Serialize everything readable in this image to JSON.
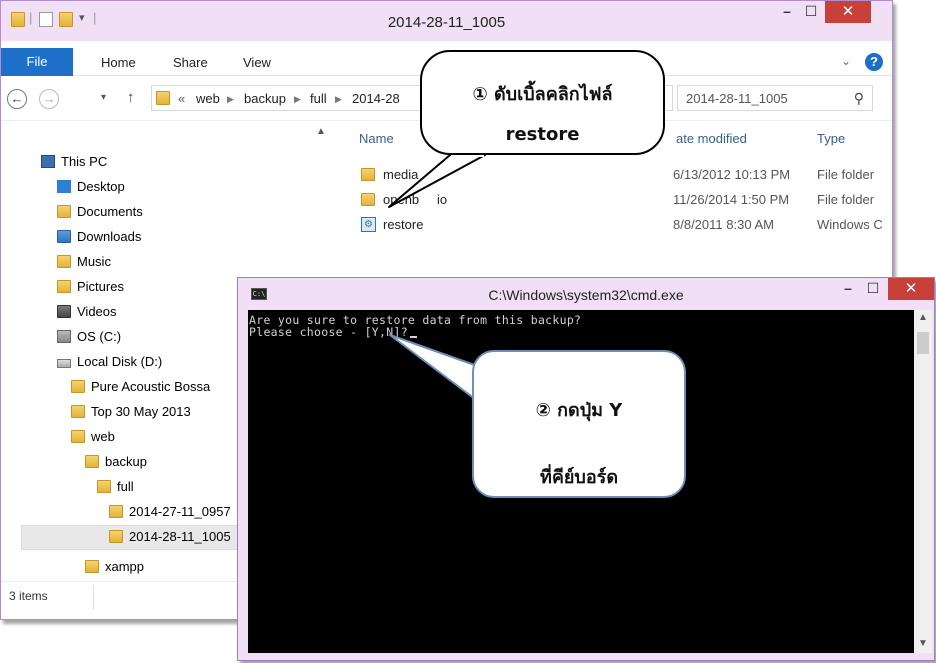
{
  "explorer": {
    "title": "2014-28-11_1005",
    "ribbon": {
      "file": "File",
      "home": "Home",
      "share": "Share",
      "view": "View",
      "help": "?"
    },
    "address": {
      "overflow": "«",
      "crumbs": [
        "web",
        "backup",
        "full",
        "2014-28"
      ]
    },
    "search_text": "2014-28-11_1005",
    "nav": {
      "this_pc": "This PC",
      "desktop": "Desktop",
      "documents": "Documents",
      "downloads": "Downloads",
      "music": "Music",
      "pictures": "Pictures",
      "videos": "Videos",
      "os": "OS (C:)",
      "local_disk": "Local Disk (D:)",
      "pure": "Pure Acoustic Bossa",
      "top30": "Top 30 May 2013",
      "web": "web",
      "backup": "backup",
      "full": "full",
      "d0957": "2014-27-11_0957",
      "d1005": "2014-28-11_1005",
      "xampp": "xampp"
    },
    "columns": {
      "name": "Name",
      "date": "ate modified",
      "type": "Type"
    },
    "files": [
      {
        "name": "media",
        "date": "6/13/2012 10:13 PM",
        "type": "File folder",
        "icon": "folder-icon"
      },
      {
        "name": "openbiblio",
        "visible_name": "openb",
        "visible_tail": "io",
        "date": "11/26/2014 1:50 PM",
        "type": "File folder",
        "icon": "folder-icon"
      },
      {
        "name": "restore",
        "date": "8/8/2011 8:30 AM",
        "type": "Windows C",
        "icon": "batch-file-icon"
      }
    ],
    "status": "3 items"
  },
  "cmd": {
    "title": "C:\\Windows\\system32\\cmd.exe",
    "icon_text": "C:\\",
    "lines": [
      "Are you sure to restore data from this backup?",
      "Please choose - [Y,N]?"
    ]
  },
  "callouts": {
    "one_line1": "① ดับเบิ้ลคลิกไฟล์",
    "one_line2": "restore",
    "two_line1": "② กดปุ่ม Y",
    "two_line2": "ที่คีย์บอร์ด"
  },
  "colors": {
    "titlebar": "#f0dff5",
    "close": "#c7403a",
    "file_tab": "#1e6fc8",
    "console_bg": "#000000"
  }
}
